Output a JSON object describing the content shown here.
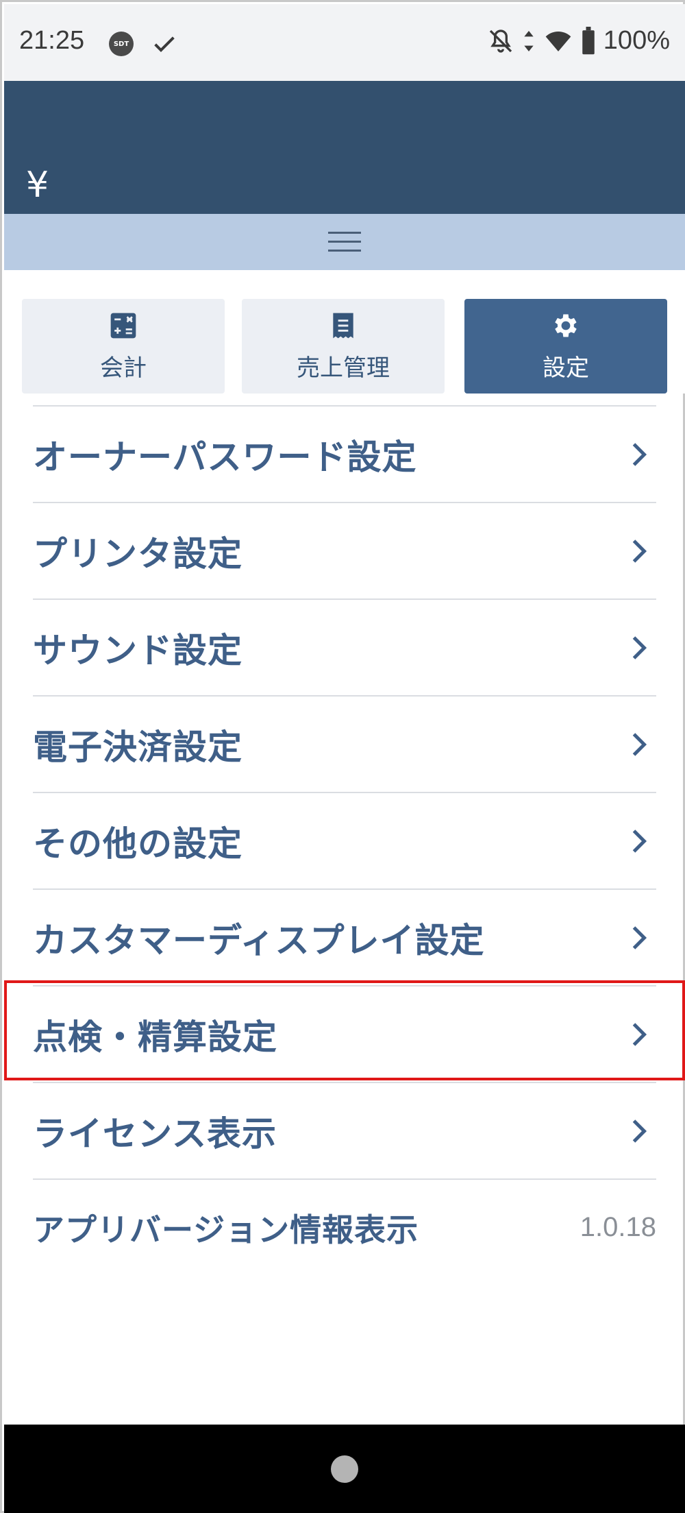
{
  "status_bar": {
    "time": "21:25",
    "sdt_badge": "SDT",
    "battery_percent": "100%",
    "icons": [
      "sdt-badge-icon",
      "check-icon",
      "bell-off-icon",
      "data-arrows-icon",
      "wifi-icon",
      "battery-icon"
    ]
  },
  "header": {
    "currency_symbol": "¥",
    "menu_icon": "hamburger-menu-icon"
  },
  "tabs": [
    {
      "label": "会計",
      "icon": "calculator-icon",
      "active": false
    },
    {
      "label": "売上管理",
      "icon": "receipt-icon",
      "active": false
    },
    {
      "label": "設定",
      "icon": "gear-icon",
      "active": true
    }
  ],
  "settings": {
    "items": [
      {
        "label": "オーナーパスワード設定"
      },
      {
        "label": "プリンタ設定"
      },
      {
        "label": "サウンド設定"
      },
      {
        "label": "電子決済設定"
      },
      {
        "label": "その他の設定"
      },
      {
        "label": "カスタマーディスプレイ設定"
      },
      {
        "label": "点検・精算設定",
        "highlighted": true
      },
      {
        "label": "ライセンス表示"
      }
    ],
    "version_label": "アプリバージョン情報表示",
    "version_value": "1.0.18"
  },
  "colors": {
    "header": "#33506e",
    "menubar": "#b8cbe3",
    "tab_active": "#41658f",
    "tab_inactive": "#eceff4",
    "item_text": "#3f5f88",
    "highlight": "#e01818"
  }
}
